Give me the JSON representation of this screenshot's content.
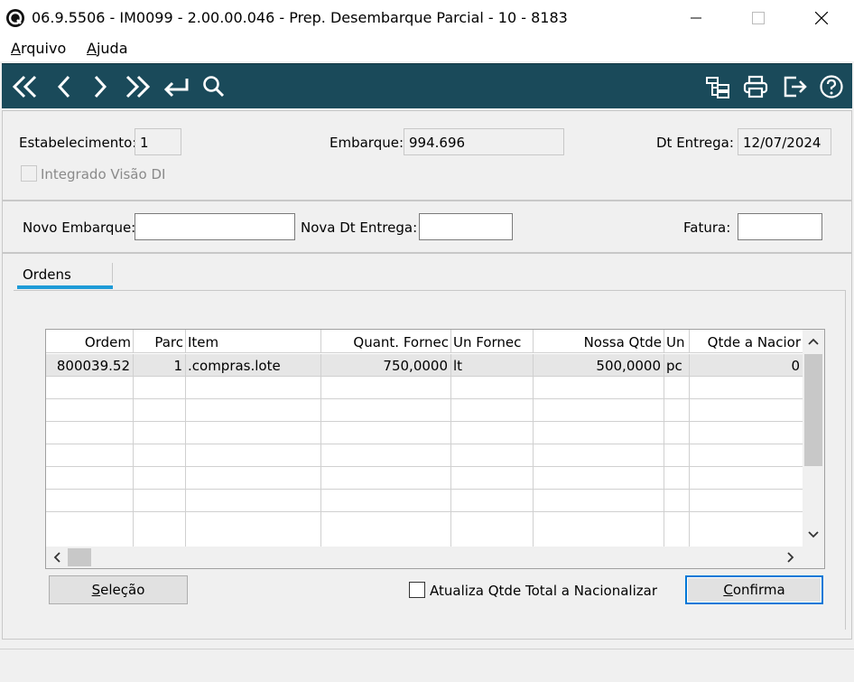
{
  "window": {
    "title": "06.9.5506 - IM0099 - 2.00.00.046 - Prep. Desembarque Parcial - 10 - 8183"
  },
  "menu": {
    "items": [
      {
        "label_first": "A",
        "label_rest": "rquivo"
      },
      {
        "label_first": "A",
        "label_rest": "juda"
      }
    ]
  },
  "toolbar": {
    "accent": "#1a4a5a",
    "left_icons": [
      "first-icon",
      "previous-icon",
      "next-icon",
      "last-icon",
      "goto-icon",
      "search-icon"
    ],
    "right_icons": [
      "structure-icon",
      "print-icon",
      "exit-icon",
      "help-icon"
    ]
  },
  "header": {
    "estabelecimento_label": "Estabelecimento:",
    "estabelecimento_value": "1",
    "embarque_label": "Embarque:",
    "embarque_value": "994.696",
    "dt_entrega_label": "Dt Entrega:",
    "dt_entrega_value": "12/07/2024",
    "integrado_label": "Integrado Visão DI"
  },
  "params": {
    "novo_embarque_label": "Novo Embarque:",
    "novo_embarque_value": "",
    "nova_dt_label": "Nova Dt Entrega:",
    "nova_dt_value": "",
    "fatura_label": "Fatura:",
    "fatura_value": ""
  },
  "tabs": [
    {
      "label": "Ordens",
      "active": true
    }
  ],
  "grid": {
    "columns": [
      "Ordem",
      "Parc",
      "Item",
      "Quant. Fornec",
      "Un Fornec",
      "Nossa Qtde",
      "Un",
      "Qtde a Nacior"
    ],
    "rows": [
      [
        "800039.52",
        "1",
        ".compras.lote",
        "750,0000",
        "lt",
        "500,0000",
        "pc",
        "0"
      ]
    ]
  },
  "actions": {
    "selecao_first": "S",
    "selecao_rest": "eleção",
    "atualiza_label": "Atualiza Qtde Total a Nacionalizar",
    "confirma_first": "C",
    "confirma_rest": "onfirma"
  }
}
